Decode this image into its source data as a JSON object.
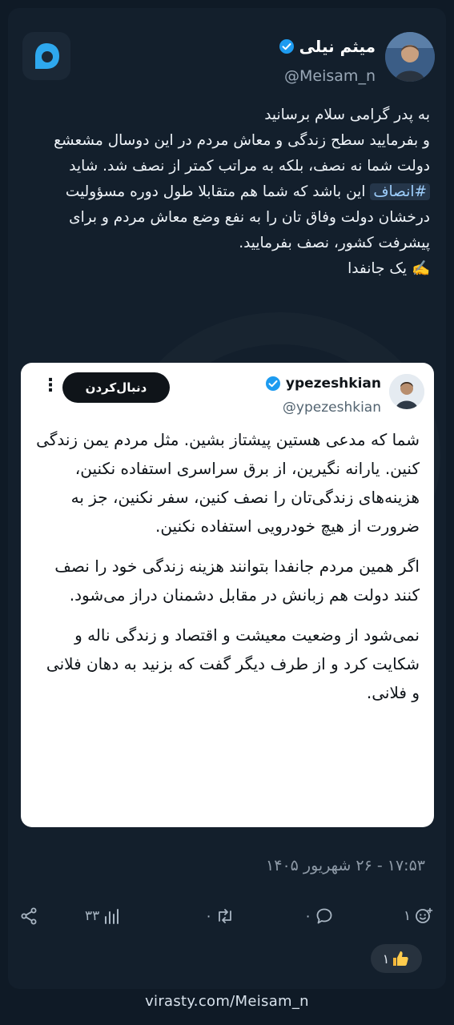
{
  "author": {
    "name": "میثم نیلی",
    "handle": "@Meisam_n"
  },
  "tweet": {
    "lines_before_tag": "به پدر گرامی سلام برسانید\nو بفرمایید سطح زندگی و معاش مردم در این دوسال مشعشع دولت شما نه نصف، بلکه به مراتب کمتر از نصف شد. شاید",
    "hashtag": "#انصاف",
    "lines_after_tag": "این باشد که شما هم متقابلا طول دوره مسؤولیت درخشان دولت وفاق تان را به نفع وضع معاش مردم و برای پیشرفت کشور، نصف بفرمایید.\n✍️ یک جانفدا"
  },
  "quote": {
    "name": "ypezeshkian",
    "handle": "@ypezeshkian",
    "follow_label": "دنبال‌کردن",
    "more_label": "⋮",
    "paragraphs": [
      "شما که مدعی هستین پیشتاز بشین. مثل مردم یمن زندگی کنین. یارانه نگیرین، از برق سراسری استفاده نکنین، هزینه‌های زندگی‌تان را نصف کنین، سفر نکنین، جز به ضرورت از هیچ خودرویی استفاده نکنین.",
      "اگر همین مردم جانفدا بتوانند هزینه زندگی خود را نصف کنند دولت هم زبانش در مقابل دشمنان دراز می‌شود.",
      "نمی‌شود از وضعیت معیشت و اقتصاد و زندگی ناله و شکایت کرد و از طرف دیگر گفت که بزنید به دهان فلانی و فلانی."
    ]
  },
  "timestamp": "۱۷:۵۳ - ۲۶ شهریور ۱۴۰۵",
  "actions": {
    "views": "۳۳",
    "reposts": "۰",
    "comments": "۰",
    "reactions": "۱"
  },
  "reaction_chip": {
    "count": "۱"
  },
  "footer": {
    "url": "virasty.com/Meisam_n"
  },
  "colors": {
    "background": "#131f2c",
    "verified": "#1d9bf0",
    "hashtag": "#9fd0ff"
  }
}
